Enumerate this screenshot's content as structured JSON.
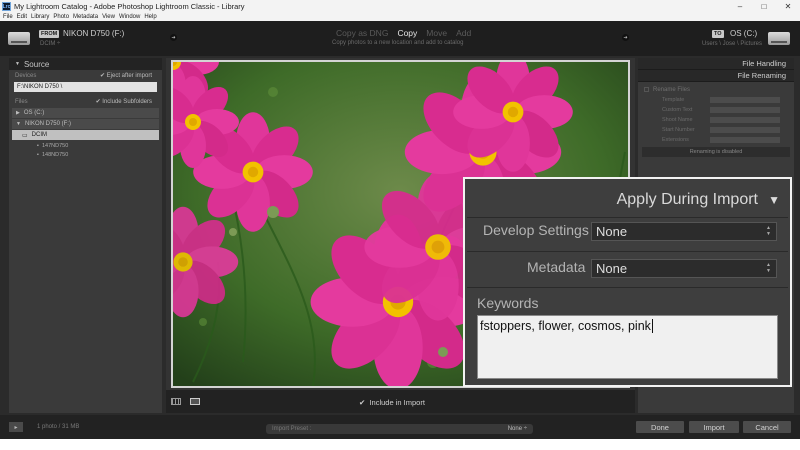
{
  "window": {
    "title": "My Lightroom Catalog - Adobe Photoshop Lightroom Classic - Library",
    "app_icon_text": "Lrc",
    "controls": {
      "minimize": "–",
      "maximize": "□",
      "close": "✕"
    }
  },
  "menu": [
    "File",
    "Edit",
    "Library",
    "Photo",
    "Metadata",
    "View",
    "Window",
    "Help"
  ],
  "header": {
    "from_label": "FROM",
    "from_device": "NIKON D750  (F:)",
    "from_sub": "DCIM ÷",
    "modes": [
      "Copy as DNG",
      "Copy",
      "Move",
      "Add"
    ],
    "active_mode": "Copy",
    "mode_desc": "Copy photos to a new location and add to catalog",
    "to_label": "TO",
    "to_device": "OS (C:)",
    "to_sub": "Users \\ Jose \\ Pictures"
  },
  "source_panel": {
    "title": "Source",
    "devices_label": "Devices",
    "eject_label": "Eject after import",
    "path": "F:\\NIKON D750 \\",
    "files_label": "Files",
    "subfolders_label": "Include Subfolders",
    "tree": [
      "OS (C:)",
      "NIKON D750  (F:)",
      "DCIM"
    ],
    "subfolders": [
      "147ND750",
      "148ND750"
    ]
  },
  "center": {
    "include_label": "Include in Import"
  },
  "right_panel": {
    "file_handling": "File Handling",
    "file_renaming": "File Renaming",
    "rename_files": "Rename Files",
    "rename_rows": [
      "Template",
      "Custom Text",
      "Shoot Name",
      "Start Number",
      "Extensions"
    ],
    "renaming_disabled": "Renaming is disabled"
  },
  "bottom": {
    "info": "1 photo / 31 MB",
    "preset_label": "Import Preset :",
    "preset_value": "None ÷",
    "done": "Done",
    "import": "Import",
    "cancel": "Cancel"
  },
  "zoom_panel": {
    "title": "Apply During Import",
    "develop_label": "Develop Settings",
    "develop_value": "None",
    "metadata_label": "Metadata",
    "metadata_value": "None",
    "keywords_label": "Keywords",
    "keywords_value": "fstoppers, flower, cosmos, pink"
  },
  "colors": {
    "app_bg": "#2b2b2b",
    "panel_bg": "#3a3a3a",
    "flower_pink": "#e0369a",
    "flower_center": "#f2c200",
    "foliage": "#3e6b28"
  }
}
